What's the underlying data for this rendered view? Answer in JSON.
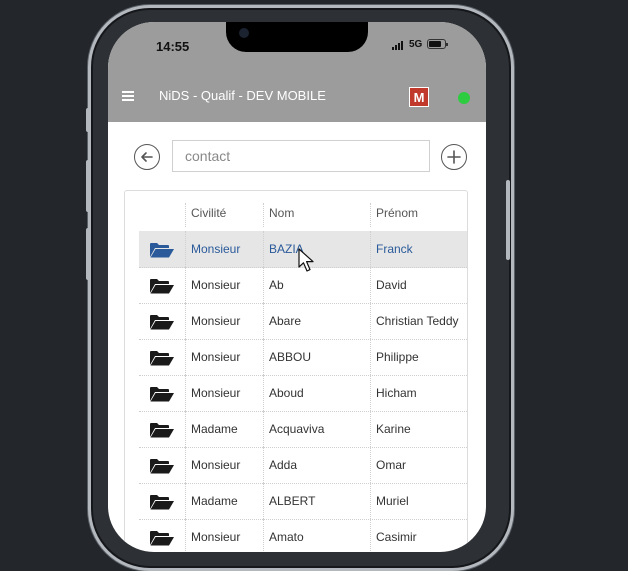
{
  "status": {
    "time": "14:55",
    "network": "5G"
  },
  "app": {
    "title": "NiDS - Qualif - DEV MOBILE",
    "user_badge": "M",
    "online_color": "#2ecc40"
  },
  "search": {
    "value": "",
    "placeholder": "contact"
  },
  "table": {
    "headers": {
      "civilite": "Civilité",
      "nom": "Nom",
      "prenom": "Prénom"
    },
    "rows": [
      {
        "civilite": "Monsieur",
        "nom": "BAZIA",
        "prenom": "Franck",
        "selected": true
      },
      {
        "civilite": "Monsieur",
        "nom": "Ab",
        "prenom": "David"
      },
      {
        "civilite": "Monsieur",
        "nom": "Abare",
        "prenom": "Christian Teddy"
      },
      {
        "civilite": "Monsieur",
        "nom": "ABBOU",
        "prenom": "Philippe"
      },
      {
        "civilite": "Monsieur",
        "nom": "Aboud",
        "prenom": "Hicham"
      },
      {
        "civilite": "Madame",
        "nom": "Acquaviva",
        "prenom": "Karine"
      },
      {
        "civilite": "Monsieur",
        "nom": "Adda",
        "prenom": "Omar"
      },
      {
        "civilite": "Madame",
        "nom": "ALBERT",
        "prenom": "Muriel"
      },
      {
        "civilite": "Monsieur",
        "nom": "Amato",
        "prenom": "Casimir"
      }
    ]
  },
  "icons": {
    "row": "open-folder-icon",
    "back": "arrow-left-circle-icon",
    "add": "plus-circle-icon"
  },
  "colors": {
    "selected_text": "#2a5a9a",
    "folder_selected": "#2a5a9a",
    "badge": "#c0392b",
    "header_bar": "#9c9c9c"
  }
}
